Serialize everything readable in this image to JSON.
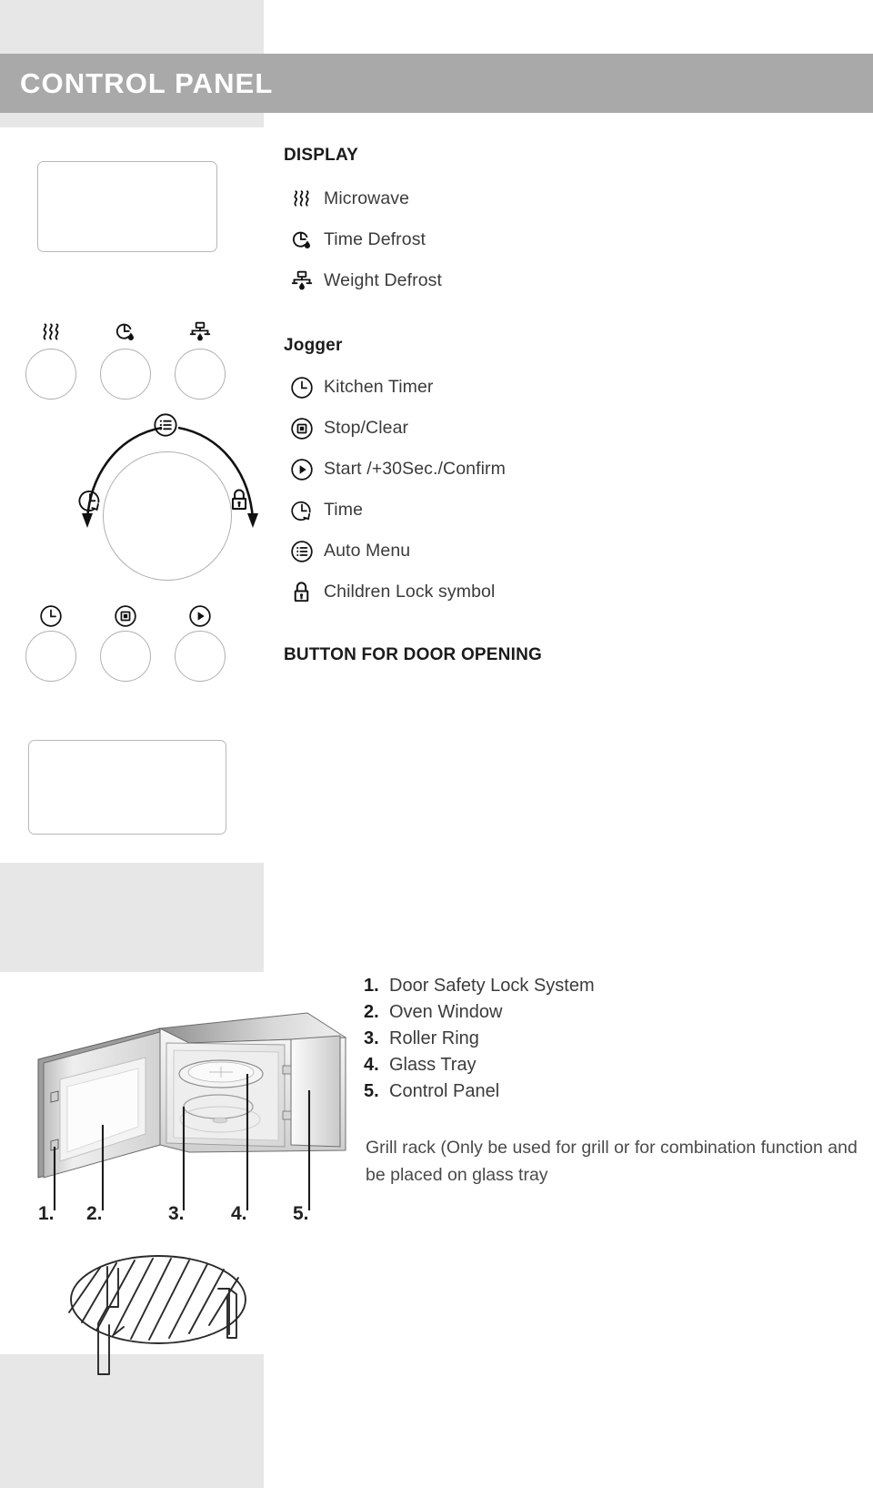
{
  "title": "CONTROL PANEL",
  "display_section": {
    "heading": "DISPLAY",
    "items": [
      {
        "icon": "microwave-waves-icon",
        "label": "Microwave"
      },
      {
        "icon": "clock-droplet-icon",
        "label": "Time Defrost"
      },
      {
        "icon": "weight-droplet-icon",
        "label": "Weight Defrost"
      }
    ]
  },
  "jogger_section": {
    "heading": "Jogger",
    "items": [
      {
        "icon": "kitchen-timer-icon",
        "label": "Kitchen Timer"
      },
      {
        "icon": "stop-clear-icon",
        "label": "Stop/Clear"
      },
      {
        "icon": "start-play-icon",
        "label": "Start /+30Sec./Confirm"
      },
      {
        "icon": "time-clock-arrow-icon",
        "label": "Time"
      },
      {
        "icon": "auto-menu-list-icon",
        "label": "Auto Menu"
      },
      {
        "icon": "children-lock-padlock-icon",
        "label": "Children Lock symbol"
      }
    ]
  },
  "door_section": {
    "heading": "BUTTON FOR DOOR OPENING"
  },
  "parts_list": [
    {
      "number": "1.",
      "label": "Door Safety Lock System"
    },
    {
      "number": "2.",
      "label": "Oven Window"
    },
    {
      "number": "3.",
      "label": "Roller Ring"
    },
    {
      "number": "4.",
      "label": "Glass Tray"
    },
    {
      "number": "5.",
      "label": "Control Panel"
    }
  ],
  "leader_numbers": [
    "1.",
    "2.",
    "3.",
    "4.",
    "5."
  ],
  "grill_note": "Grill rack (Only be used for grill or for combination function and be placed on glass tray",
  "colors": {
    "title_bar": "#a9a9a9",
    "band": "#e7e7e7",
    "text": "#3b3b3b",
    "heading": "#1b1b1b"
  }
}
